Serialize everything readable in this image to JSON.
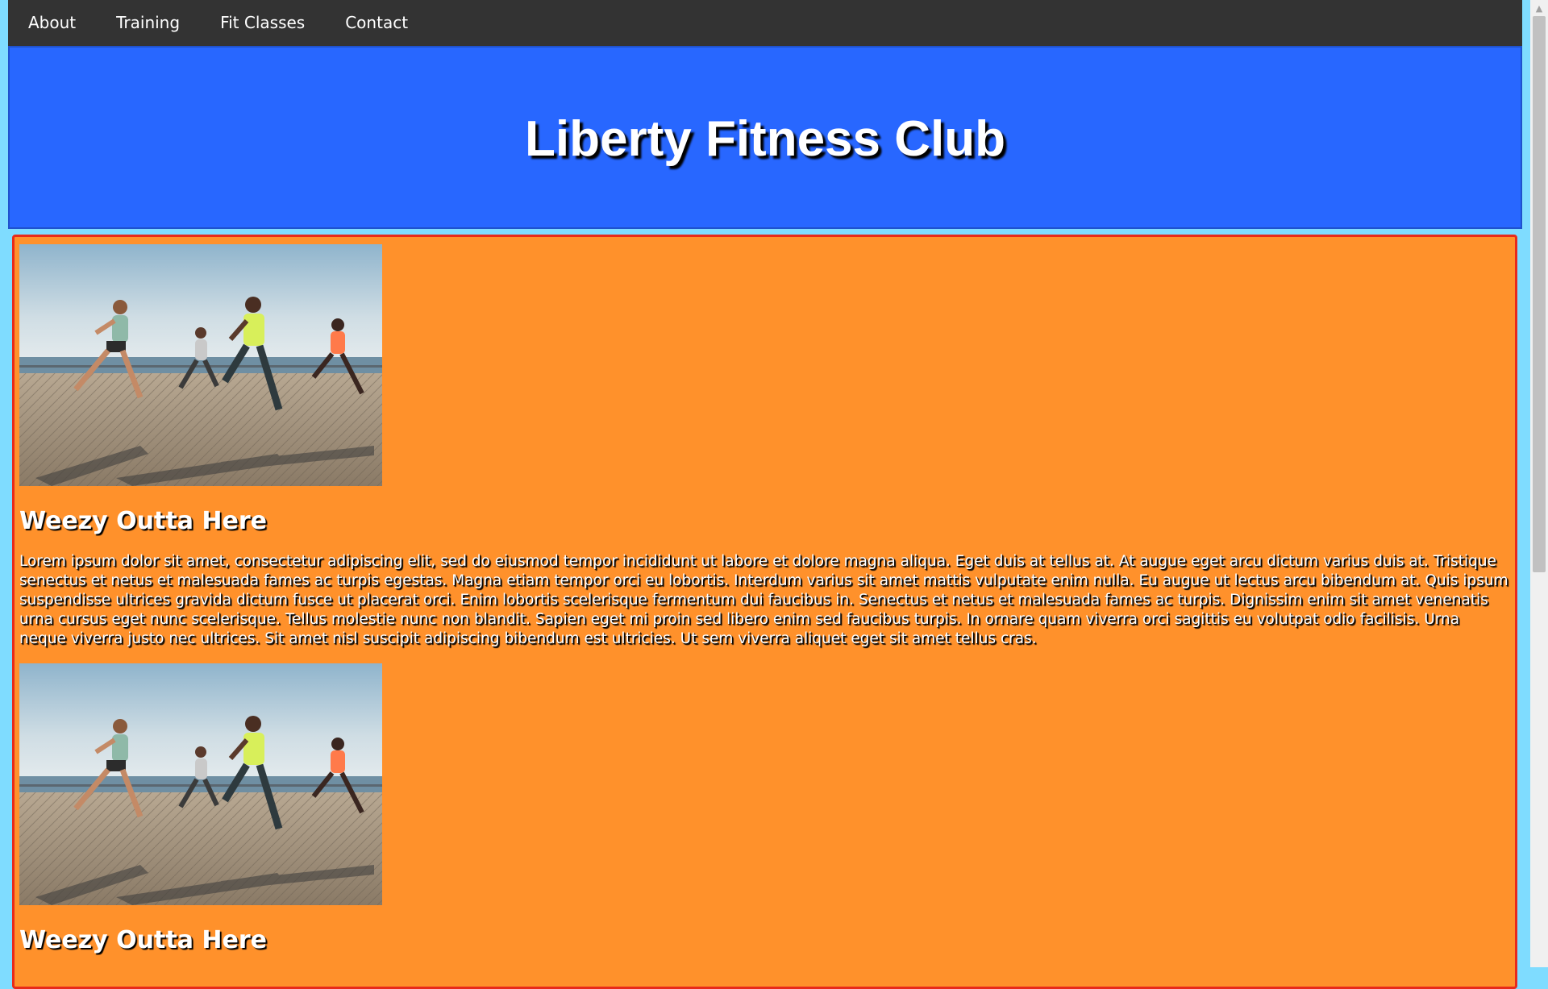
{
  "nav": {
    "items": [
      {
        "label": "About"
      },
      {
        "label": "Training"
      },
      {
        "label": "Fit Classes"
      },
      {
        "label": "Contact"
      }
    ]
  },
  "header": {
    "title": "Liberty Fitness Club"
  },
  "articles": [
    {
      "image_alt": "runners-photo",
      "title": "Weezy Outta Here",
      "body": "Lorem ipsum dolor sit amet, consectetur adipiscing elit, sed do eiusmod tempor incididunt ut labore et dolore magna aliqua. Eget duis at tellus at. At augue eget arcu dictum varius duis at. Tristique senectus et netus et malesuada fames ac turpis egestas. Magna etiam tempor orci eu lobortis. Interdum varius sit amet mattis vulputate enim nulla. Eu augue ut lectus arcu bibendum at. Quis ipsum suspendisse ultrices gravida dictum fusce ut placerat orci. Enim lobortis scelerisque fermentum dui faucibus in. Senectus et netus et malesuada fames ac turpis. Dignissim enim sit amet venenatis urna cursus eget nunc scelerisque. Tellus molestie nunc non blandit. Sapien eget mi proin sed libero enim sed faucibus turpis. In ornare quam viverra orci sagittis eu volutpat odio facilisis. Urna neque viverra justo nec ultrices. Sit amet nisl suscipit adipiscing bibendum est ultricies. Ut sem viverra aliquet eget sit amet tellus cras."
    },
    {
      "image_alt": "runners-photo",
      "title": "Weezy Outta Here",
      "body": ""
    }
  ],
  "colors": {
    "navbar": "#333333",
    "header": "#2867ff",
    "content": "#ff912b",
    "content_border": "#e82a1a",
    "page_background": "#7fdcff"
  }
}
